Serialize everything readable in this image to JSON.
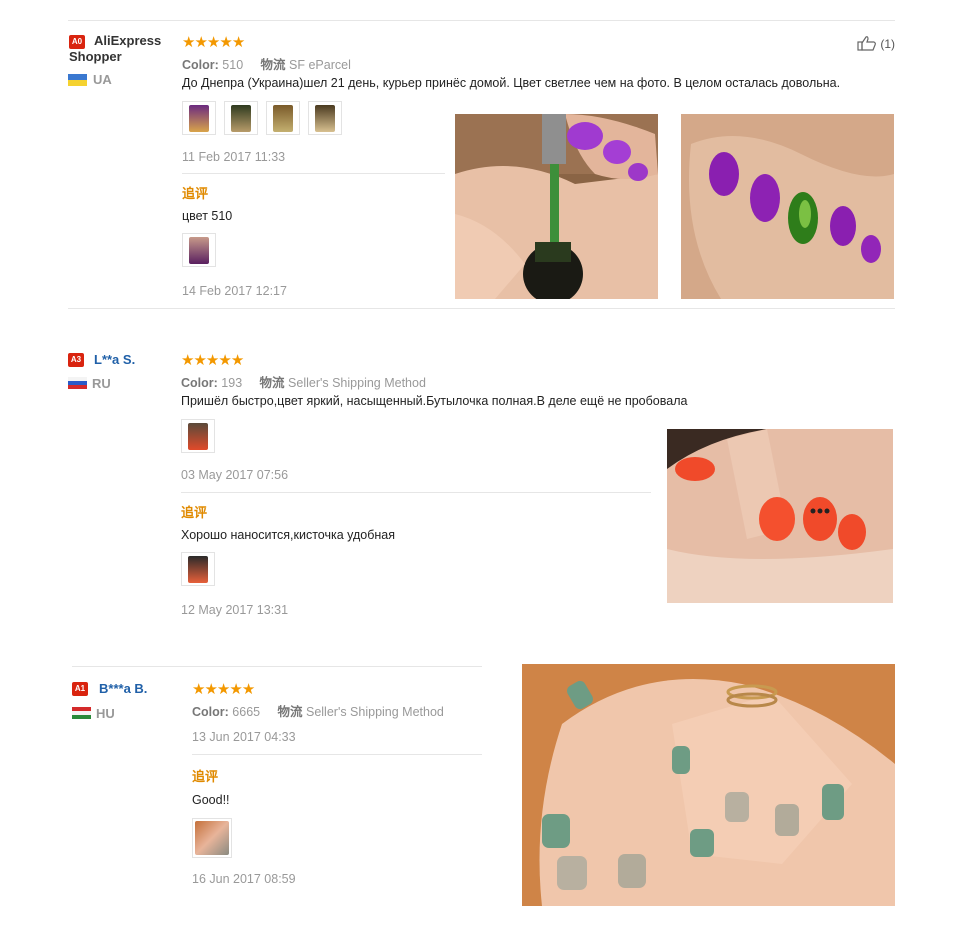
{
  "reviews": [
    {
      "badge": "A0",
      "name": "AliExpress Shopper",
      "country": "UA",
      "color_label": "Color:",
      "color_value": "510",
      "shipping_label": "物流",
      "shipping_value": "SF eParcel",
      "text": "До Днепра (Украина)шел 21 день, курьер принёс домой. Цвет светлее чем на фото. В целом осталась довольна.",
      "date": "11 Feb 2017 11:33",
      "likes": "(1)",
      "followup_label": "追评",
      "followup_text": "цвет 510",
      "followup_date": "14 Feb 2017 12:17"
    },
    {
      "badge": "A3",
      "name": "L**a S.",
      "country": "RU",
      "color_label": "Color:",
      "color_value": "193",
      "shipping_label": "物流",
      "shipping_value": "Seller's Shipping Method",
      "text": "Пришёл быстро,цвет яркий, насыщенный.Бутылочка полная.В деле ещё не пробовала",
      "date": "03 May 2017 07:56",
      "followup_label": "追评",
      "followup_text": "Хорошо наносится,кисточка удобная",
      "followup_date": "12 May 2017 13:31"
    },
    {
      "badge": "A1",
      "name": "B***a B.",
      "country": "HU",
      "color_label": "Color:",
      "color_value": "6665",
      "shipping_label": "物流",
      "shipping_value": "Seller's Shipping Method",
      "date": "13 Jun 2017 04:33",
      "followup_label": "追评",
      "followup_text": "Good!!",
      "followup_date": "16 Jun 2017 08:59"
    }
  ],
  "rating_stars": 5,
  "colors": {
    "star": "#f39800",
    "badge": "#d9240f",
    "followup": "#e08a00",
    "link_blue": "#2060a8"
  }
}
